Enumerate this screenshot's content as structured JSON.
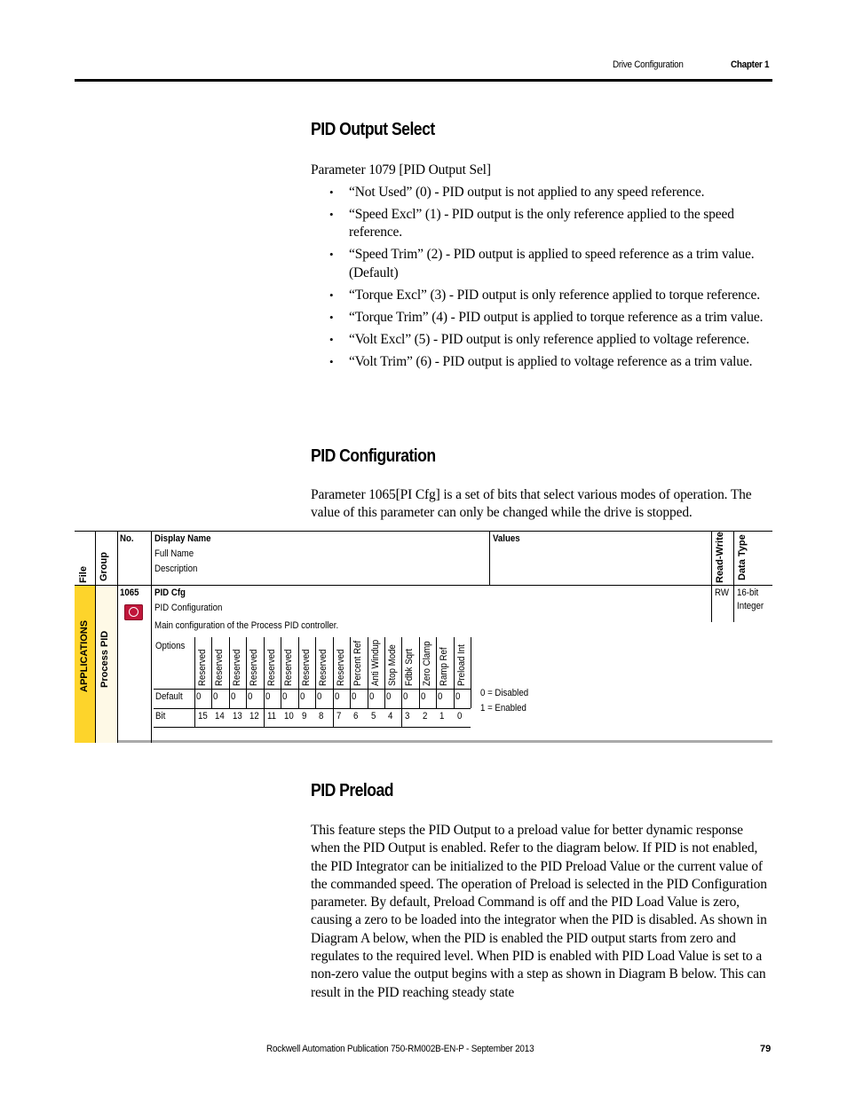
{
  "header": {
    "section": "Drive Configuration",
    "chapter": "Chapter 1"
  },
  "sections": {
    "output_select": {
      "title": "PID Output Select",
      "intro": "Parameter 1079 [PID Output Sel]",
      "bullets": [
        "“Not Used” (0) - PID output is not applied to any speed reference.",
        "“Speed Excl” (1) - PID output is the only reference applied to the speed reference.",
        "“Speed Trim” (2) - PID output is applied to speed reference as a trim value. (Default)",
        "“Torque Excl” (3) - PID output is only reference applied to torque reference.",
        "“Torque Trim” (4) - PID output is applied to torque reference as a trim value.",
        "“Volt Excl” (5) - PID output is only reference applied to voltage reference.",
        "“Volt Trim” (6) - PID output is applied to voltage reference as a trim value."
      ]
    },
    "configuration": {
      "title": "PID Configuration",
      "text": "Parameter 1065[PI Cfg] is a set of bits that select various modes of operation. The value of this parameter can only be changed while the drive is stopped."
    },
    "preload": {
      "title": "PID Preload",
      "text": "This feature steps the PID Output to a preload value for better dynamic response when the PID Output is enabled. Refer to the diagram below. If PID is not enabled, the PID Integrator can be initialized to the PID Preload Value or the current value of the commanded speed. The operation of Preload is selected in the PID Configuration parameter. By default, Preload Command is off and the PID Load Value is zero, causing a zero to be loaded into the integrator when the PID is disabled. As shown in Diagram A below, when the PID is enabled the PID output starts from zero and regulates to the required level. When PID is enabled with PID Load Value is set to a non-zero value the output begins with a step as shown in Diagram B below. This can result in the PID reaching steady state"
    }
  },
  "param_table": {
    "headers": {
      "file": "File",
      "group": "Group",
      "no": "No.",
      "display_name": "Display Name",
      "full_name": "Full Name",
      "description": "Description",
      "values": "Values",
      "read_write": "Read-Write",
      "data_type": "Data Type"
    },
    "row": {
      "file": "APPLICATIONS",
      "group": "Process PID",
      "no": "1065",
      "icon": "stop-required-icon",
      "display_name": "PID Cfg",
      "full_name": "PID Configuration",
      "description": "Main configuration of the Process PID controller.",
      "read_write": "RW",
      "data_type_line1": "16-bit",
      "data_type_line2": "Integer",
      "value_legend": [
        "0 = Disabled",
        "1 = Enabled"
      ],
      "bits_table": {
        "row_labels": {
          "options": "Options",
          "default": "Default",
          "bit": "Bit"
        },
        "options": [
          "Reserved",
          "Reserved",
          "Reserved",
          "Reserved",
          "Reserved",
          "Reserved",
          "Reserved",
          "Reserved",
          "Reserved",
          "Percent Ref",
          "Anti Windup",
          "Stop Mode",
          "Fdbk Sqrt",
          "Zero Clamp",
          "Ramp Ref",
          "Preload Int"
        ],
        "defaults": [
          "0",
          "0",
          "0",
          "0",
          "0",
          "0",
          "0",
          "0",
          "0",
          "0",
          "0",
          "0",
          "0",
          "0",
          "0",
          "0"
        ],
        "bits": [
          "15",
          "14",
          "13",
          "12",
          "11",
          "10",
          "9",
          "8",
          "7",
          "6",
          "5",
          "4",
          "3",
          "2",
          "1",
          "0"
        ]
      }
    }
  },
  "footer": {
    "publication": "Rockwell Automation Publication 750-RM002B-EN-P - September 2013",
    "page": "79"
  }
}
